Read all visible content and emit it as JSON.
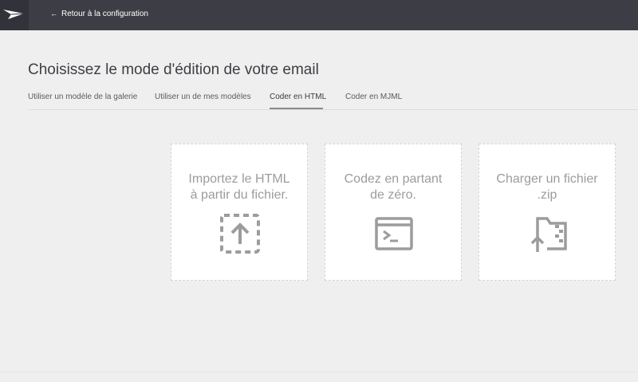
{
  "topbar": {
    "back_link": "Retour à la configuration",
    "back_arrow": "←"
  },
  "page": {
    "title": "Choisissez le mode d'édition de votre email"
  },
  "tabs": [
    {
      "label": "Utiliser un modèle de la galerie",
      "active": false
    },
    {
      "label": "Utiliser un de mes modèles",
      "active": false
    },
    {
      "label": "Coder en HTML",
      "active": true
    },
    {
      "label": "Coder en MJML",
      "active": false
    }
  ],
  "cards": [
    {
      "line1": "Importez le HTML",
      "line2": "à partir du fichier.",
      "icon": "upload-icon"
    },
    {
      "line1": "Codez en partant",
      "line2": "de zéro.",
      "icon": "terminal-icon"
    },
    {
      "line1": "Charger un fichier",
      "line2": ".zip",
      "icon": "zip-folder-icon"
    }
  ],
  "colors": {
    "topbar": "#3d3e45",
    "background": "#efefef",
    "card": "#ffffff",
    "icon": "#9c9c9c"
  }
}
